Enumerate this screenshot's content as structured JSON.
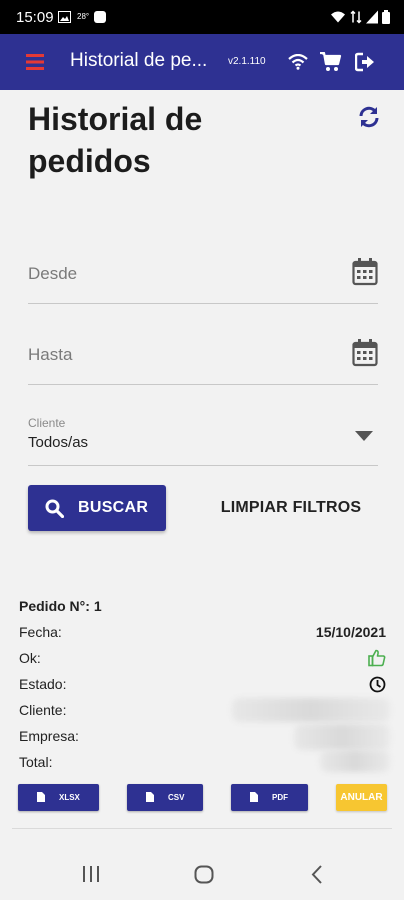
{
  "status_bar": {
    "time": "15:09",
    "temperature": "28°"
  },
  "app_bar": {
    "title": "Historial de pe...",
    "version": "v2.1.110"
  },
  "page": {
    "title": "Historial de pedidos"
  },
  "filters": {
    "desde_placeholder": "Desde",
    "hasta_placeholder": "Hasta",
    "cliente_label": "Cliente",
    "cliente_value": "Todos/as"
  },
  "actions": {
    "buscar": "BUSCAR",
    "limpiar": "LIMPIAR FILTROS"
  },
  "order": {
    "title": "Pedido N°: 1",
    "labels": {
      "fecha": "Fecha:",
      "ok": "Ok:",
      "estado": "Estado:",
      "cliente": "Cliente:",
      "empresa": "Empresa:",
      "total": "Total:"
    },
    "fecha_value": "15/10/2021",
    "ok_icon": "thumbs-up-icon",
    "estado_icon": "clock-icon",
    "buttons": {
      "xlsx": "XLSX",
      "csv": "CSV",
      "pdf": "PDF",
      "anular": "ANULAR"
    }
  },
  "colors": {
    "primary": "#2e3192",
    "menu_icon": "#e53935",
    "ok_green": "#4caf50",
    "anular": "#f7c631"
  }
}
